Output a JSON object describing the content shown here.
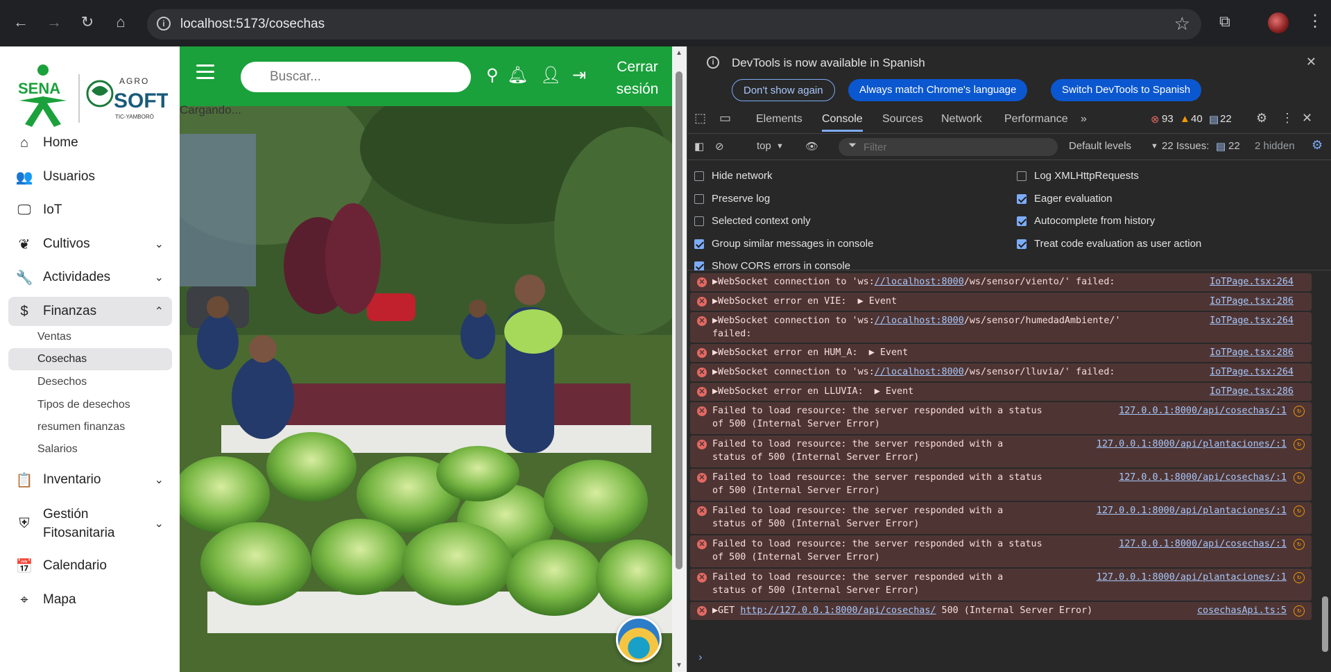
{
  "browser": {
    "url": "localhost:5173/cosechas"
  },
  "app": {
    "search_placeholder": "Buscar...",
    "logout_label": "Cerrar sesión",
    "loading_text": "Cargando...",
    "logo": {
      "left": "SENA",
      "right_top": "AGRO",
      "right_main": "SOFT",
      "right_sub": "TIC-YAMBORÓ"
    },
    "menu": [
      {
        "label": "Home",
        "icon": "home-icon"
      },
      {
        "label": "Usuarios",
        "icon": "users-icon"
      },
      {
        "label": "IoT",
        "icon": "monitor-icon"
      },
      {
        "label": "Cultivos",
        "icon": "leaf-icon",
        "expandable": true
      },
      {
        "label": "Actividades",
        "icon": "wrench-icon",
        "expandable": true
      },
      {
        "label": "Finanzas",
        "icon": "dollar-icon",
        "expanded": true
      },
      {
        "label": "Inventario",
        "icon": "clipboard-icon",
        "expandable": true
      },
      {
        "label": "Gestión Fitosanitaria",
        "icon": "shield-icon",
        "expandable": true
      },
      {
        "label": "Calendario",
        "icon": "calendar-icon"
      },
      {
        "label": "Mapa",
        "icon": "map-pin-icon"
      }
    ],
    "finanzas_sub": [
      "Ventas",
      "Cosechas",
      "Desechos",
      "Tipos de desechos",
      "resumen finanzas",
      "Salarios"
    ],
    "active_sub": "Cosechas"
  },
  "devtools": {
    "notice": "DevTools is now available in Spanish",
    "btn_dont_show": "Don't show again",
    "btn_match": "Always match Chrome's language",
    "btn_switch": "Switch DevTools to Spanish",
    "tabs": [
      "Elements",
      "Console",
      "Sources",
      "Network",
      "Performance"
    ],
    "active_tab": "Console",
    "errors": "93",
    "warnings": "40",
    "messages": "22",
    "context": "top",
    "filter_placeholder": "Filter",
    "levels": "Default levels",
    "issues_label": "22 Issues:",
    "issues_count": "22",
    "hidden": "2 hidden",
    "settings_left": [
      {
        "label": "Hide network",
        "checked": false
      },
      {
        "label": "Preserve log",
        "checked": false
      },
      {
        "label": "Selected context only",
        "checked": false
      },
      {
        "label": "Group similar messages in console",
        "checked": true
      },
      {
        "label": "Show CORS errors in console",
        "checked": true
      }
    ],
    "settings_right": [
      {
        "label": "Log XMLHttpRequests",
        "checked": false
      },
      {
        "label": "Eager evaluation",
        "checked": true
      },
      {
        "label": "Autocomplete from history",
        "checked": true
      },
      {
        "label": "Treat code evaluation as user action",
        "checked": true
      }
    ],
    "console_rows": [
      {
        "pre": "▶WebSocket connection to 'ws:",
        "link": "//localhost:8000",
        "post": "/ws/sensor/viento/' failed:",
        "src": "IoTPage.tsx:264"
      },
      {
        "pre": "▶WebSocket error en VIE:  ▶ Event",
        "src": "IoTPage.tsx:286"
      },
      {
        "pre": "▶WebSocket connection to 'ws:",
        "link": "//localhost:8000",
        "post": "/ws/sensor/humedadAmbiente/'",
        "line2": "failed:",
        "src": "IoTPage.tsx:264"
      },
      {
        "pre": "▶WebSocket error en HUM_A:  ▶ Event",
        "src": "IoTPage.tsx:286"
      },
      {
        "pre": "▶WebSocket connection to 'ws:",
        "link": "//localhost:8000",
        "post": "/ws/sensor/lluvia/' failed:",
        "src": "IoTPage.tsx:264"
      },
      {
        "pre": "▶WebSocket error en LLUVIA:  ▶ Event",
        "src": "IoTPage.tsx:286"
      },
      {
        "pre": "Failed to load resource: the server responded with a status",
        "line2": "of 500 (Internal Server Error)",
        "src": "127.0.0.1:8000/api/cosechas/:1"
      },
      {
        "pre": "Failed to load resource: the server responded with a",
        "line2": "status of 500 (Internal Server Error)",
        "src": "127.0.0.1:8000/api/plantaciones/:1"
      },
      {
        "pre": "Failed to load resource: the server responded with a status",
        "line2": "of 500 (Internal Server Error)",
        "src": "127.0.0.1:8000/api/cosechas/:1"
      },
      {
        "pre": "Failed to load resource: the server responded with a",
        "line2": "status of 500 (Internal Server Error)",
        "src": "127.0.0.1:8000/api/plantaciones/:1"
      },
      {
        "pre": "Failed to load resource: the server responded with a status",
        "line2": "of 500 (Internal Server Error)",
        "src": "127.0.0.1:8000/api/cosechas/:1"
      },
      {
        "pre": "Failed to load resource: the server responded with a",
        "line2": "status of 500 (Internal Server Error)",
        "src": "127.0.0.1:8000/api/plantaciones/:1"
      },
      {
        "pre": "▶GET ",
        "link": "http://127.0.0.1:8000/api/cosechas/",
        "post": " 500 (Internal Server Error)",
        "src": "cosechasApi.ts:5"
      }
    ]
  },
  "colors": {
    "brand_green": "#1aa13b",
    "error_bg": "#4e3534",
    "link": "#a8c7fa"
  }
}
